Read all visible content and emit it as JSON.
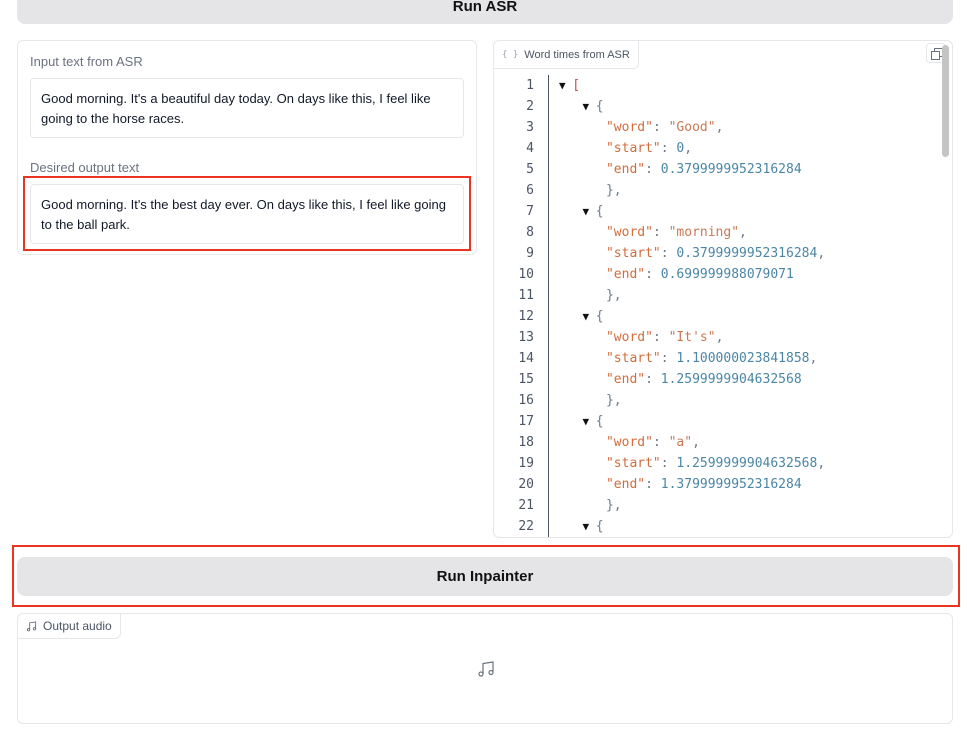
{
  "buttons": {
    "run_asr": "Run ASR",
    "run_inpainter": "Run Inpainter"
  },
  "input_panel": {
    "asr_label": "Input text from ASR",
    "asr_text": "Good morning. It's a beautiful day today. On days like this, I feel like going to the horse races.",
    "desired_label": "Desired output text",
    "desired_text": "Good morning. It's the best day ever. On days like this, I feel like going to the ball park."
  },
  "json_panel": {
    "label": "Word times from ASR",
    "tab_icon": "{ }",
    "lines": [
      {
        "n": "1",
        "type": "open_array"
      },
      {
        "n": "2",
        "type": "open_obj"
      },
      {
        "n": "3",
        "key": "\"word\"",
        "val": "\"Good\"",
        "vtype": "str",
        "comma": true
      },
      {
        "n": "4",
        "key": "\"start\"",
        "val": "0",
        "vtype": "num",
        "comma": true
      },
      {
        "n": "5",
        "key": "\"end\"",
        "val": "0.3799999952316284",
        "vtype": "num",
        "comma": false
      },
      {
        "n": "6",
        "type": "close_obj"
      },
      {
        "n": "7",
        "type": "open_obj"
      },
      {
        "n": "8",
        "key": "\"word\"",
        "val": "\"morning\"",
        "vtype": "str",
        "comma": true
      },
      {
        "n": "9",
        "key": "\"start\"",
        "val": "0.3799999952316284",
        "vtype": "num",
        "comma": true
      },
      {
        "n": "10",
        "key": "\"end\"",
        "val": "0.699999988079071",
        "vtype": "num",
        "comma": false
      },
      {
        "n": "11",
        "type": "close_obj"
      },
      {
        "n": "12",
        "type": "open_obj"
      },
      {
        "n": "13",
        "key": "\"word\"",
        "val": "\"It's\"",
        "vtype": "str",
        "comma": true
      },
      {
        "n": "14",
        "key": "\"start\"",
        "val": "1.100000023841858",
        "vtype": "num",
        "comma": true
      },
      {
        "n": "15",
        "key": "\"end\"",
        "val": "1.2599999904632568",
        "vtype": "num",
        "comma": false
      },
      {
        "n": "16",
        "type": "close_obj"
      },
      {
        "n": "17",
        "type": "open_obj"
      },
      {
        "n": "18",
        "key": "\"word\"",
        "val": "\"a\"",
        "vtype": "str",
        "comma": true
      },
      {
        "n": "19",
        "key": "\"start\"",
        "val": "1.2599999904632568",
        "vtype": "num",
        "comma": true
      },
      {
        "n": "20",
        "key": "\"end\"",
        "val": "1.3799999952316284",
        "vtype": "num",
        "comma": false
      },
      {
        "n": "21",
        "type": "close_obj"
      },
      {
        "n": "22",
        "type": "open_obj"
      }
    ]
  },
  "audio_panel": {
    "label": "Output audio",
    "tab_icon": "music-note-icon",
    "placeholder_icon": "music-note-icon"
  },
  "colors": {
    "highlight": "#ea3323",
    "button_bg": "#e5e5e7"
  }
}
